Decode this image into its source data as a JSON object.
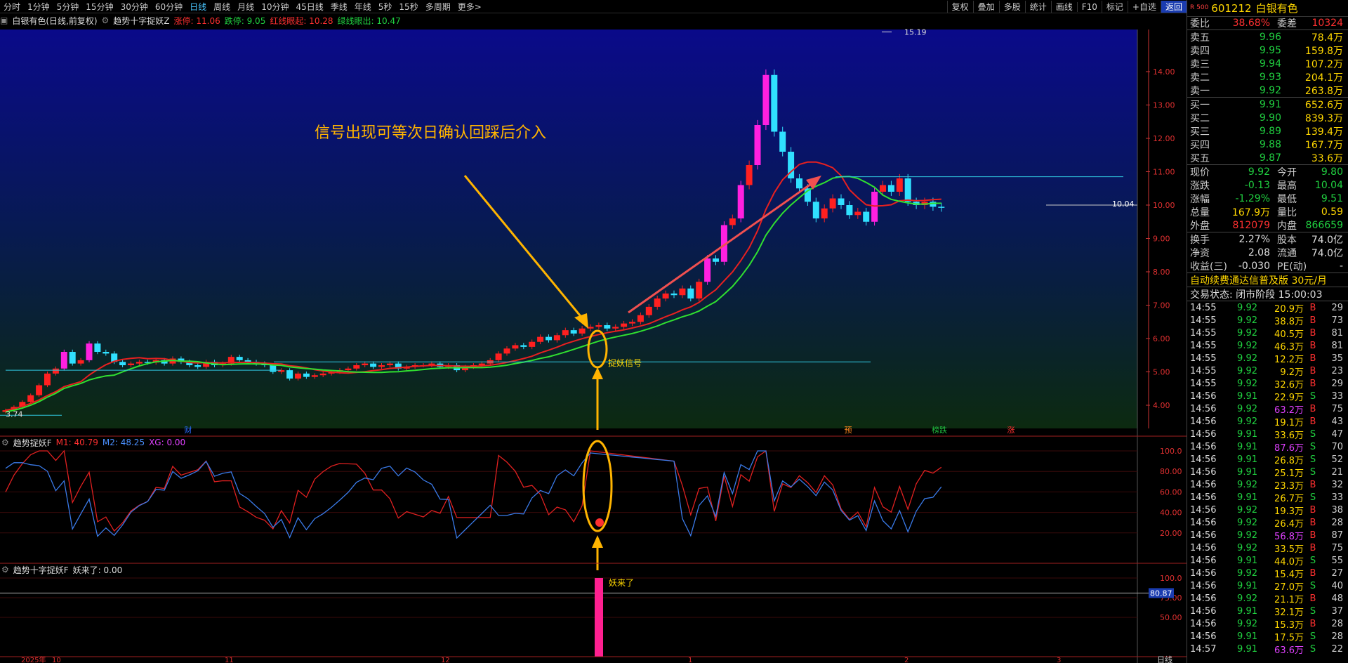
{
  "toolbar": {
    "periods": [
      "分时",
      "1分钟",
      "5分钟",
      "15分钟",
      "30分钟",
      "60分钟",
      "日线",
      "周线",
      "月线",
      "10分钟",
      "45日线",
      "季线",
      "年线",
      "5秒",
      "15秒",
      "多周期",
      "更多>"
    ],
    "active_period": "日线",
    "tools": [
      "复权",
      "叠加",
      "多股",
      "统计",
      "画线",
      "F10",
      "标记",
      "+自选",
      "返回"
    ],
    "active_tool": "返回"
  },
  "main": {
    "title": "白银有色(日线,前复权)",
    "indicator": "趋势十字捉妖Z",
    "limit_up": "涨停: 11.06",
    "limit_down": "跌停: 9.05",
    "red_line": "红线眼起: 10.28",
    "green_line": "绿线眼出: 10.47",
    "y_labels": [
      "14.00",
      "13.00",
      "12.00",
      "11.00",
      "10.00",
      "9.00",
      "8.00",
      "7.00",
      "6.00",
      "5.00",
      "4.00"
    ],
    "high_label": "15.19",
    "low_label": "3.74",
    "current_price_label": "10.04",
    "annotation": "信号出现可等次日确认回踩后介入",
    "signal_label": "捉妖信号",
    "event_badges": [
      "财",
      "预",
      "榜跌",
      "涨"
    ]
  },
  "ind1": {
    "name": "趋势捉妖F",
    "m1": "M1: 40.79",
    "m2": "M2: 48.25",
    "xg": "XG: 0.00",
    "y_labels": [
      "100.0",
      "80.00",
      "60.00",
      "40.00",
      "20.00"
    ]
  },
  "ind2": {
    "name": "趋势十字捉妖F",
    "value": "妖来了: 0.00",
    "y_labels": [
      "100.0",
      "75.00",
      "50.00"
    ],
    "cursor_value": "80.87",
    "bar_label": "妖来了"
  },
  "xaxis": {
    "labels": [
      "2025年",
      "10",
      "11",
      "12",
      "1",
      "2",
      "3"
    ],
    "corner": "日线"
  },
  "quote": {
    "code": "601212",
    "name": "白银有色",
    "badge": "R 500",
    "ratio": {
      "label": "委比",
      "value": "38.68%",
      "label2": "委差",
      "value2": "10324"
    },
    "asks": [
      {
        "label": "卖五",
        "price": "9.96",
        "vol": "78.4万"
      },
      {
        "label": "卖四",
        "price": "9.95",
        "vol": "159.8万"
      },
      {
        "label": "卖三",
        "price": "9.94",
        "vol": "107.2万"
      },
      {
        "label": "卖二",
        "price": "9.93",
        "vol": "204.1万"
      },
      {
        "label": "卖一",
        "price": "9.92",
        "vol": "263.8万"
      }
    ],
    "bids": [
      {
        "label": "买一",
        "price": "9.91",
        "vol": "652.6万"
      },
      {
        "label": "买二",
        "price": "9.90",
        "vol": "839.3万"
      },
      {
        "label": "买三",
        "price": "9.89",
        "vol": "139.4万"
      },
      {
        "label": "买四",
        "price": "9.88",
        "vol": "167.7万"
      },
      {
        "label": "买五",
        "price": "9.87",
        "vol": "33.6万"
      }
    ],
    "stats": [
      {
        "l1": "现价",
        "v1": "9.92",
        "c1": "down",
        "l2": "今开",
        "v2": "9.80",
        "c2": "down"
      },
      {
        "l1": "涨跌",
        "v1": "-0.13",
        "c1": "down",
        "l2": "最高",
        "v2": "10.04",
        "c2": "down"
      },
      {
        "l1": "涨幅",
        "v1": "-1.29%",
        "c1": "down",
        "l2": "最低",
        "v2": "9.51",
        "c2": "down"
      },
      {
        "l1": "总量",
        "v1": "167.9万",
        "c1": "yel",
        "l2": "量比",
        "v2": "0.59",
        "c2": "yel"
      },
      {
        "l1": "外盘",
        "v1": "812079",
        "c1": "up",
        "l2": "内盘",
        "v2": "866659",
        "c2": "down"
      }
    ],
    "stats2": [
      {
        "l1": "换手",
        "v1": "2.27%",
        "l2": "股本",
        "v2": "74.0亿"
      },
      {
        "l1": "净资",
        "v1": "2.08",
        "l2": "流通",
        "v2": "74.0亿"
      },
      {
        "l1": "收益(三)",
        "v1": "-0.030",
        "l2": "PE(动)",
        "v2": "-"
      }
    ],
    "ad": "自动续费通达信普及版  30元/月",
    "trade_status": "交易状态: 闭市阶段 15:00:03"
  },
  "ticks": [
    {
      "t": "14:55",
      "p": "9.92",
      "v": "20.9万",
      "bs": "B",
      "n": "29"
    },
    {
      "t": "14:55",
      "p": "9.92",
      "v": "38.8万",
      "bs": "B",
      "n": "73"
    },
    {
      "t": "14:55",
      "p": "9.92",
      "v": "40.5万",
      "bs": "B",
      "n": "81"
    },
    {
      "t": "14:55",
      "p": "9.92",
      "v": "46.3万",
      "bs": "B",
      "n": "81"
    },
    {
      "t": "14:55",
      "p": "9.92",
      "v": "12.2万",
      "bs": "B",
      "n": "35"
    },
    {
      "t": "14:55",
      "p": "9.92",
      "v": "9.2万",
      "bs": "B",
      "n": "23"
    },
    {
      "t": "14:55",
      "p": "9.92",
      "v": "32.6万",
      "bs": "B",
      "n": "29"
    },
    {
      "t": "14:56",
      "p": "9.91",
      "v": "22.9万",
      "bs": "S",
      "n": "33"
    },
    {
      "t": "14:56",
      "p": "9.92",
      "v": "63.2万",
      "bs": "B",
      "n": "75",
      "hl": true
    },
    {
      "t": "14:56",
      "p": "9.92",
      "v": "19.1万",
      "bs": "B",
      "n": "43"
    },
    {
      "t": "14:56",
      "p": "9.91",
      "v": "33.6万",
      "bs": "S",
      "n": "47"
    },
    {
      "t": "14:56",
      "p": "9.91",
      "v": "87.6万",
      "bs": "S",
      "n": "70",
      "hl": true
    },
    {
      "t": "14:56",
      "p": "9.91",
      "v": "26.8万",
      "bs": "S",
      "n": "52"
    },
    {
      "t": "14:56",
      "p": "9.91",
      "v": "25.1万",
      "bs": "S",
      "n": "21"
    },
    {
      "t": "14:56",
      "p": "9.92",
      "v": "23.3万",
      "bs": "B",
      "n": "32"
    },
    {
      "t": "14:56",
      "p": "9.91",
      "v": "26.7万",
      "bs": "S",
      "n": "33"
    },
    {
      "t": "14:56",
      "p": "9.92",
      "v": "19.3万",
      "bs": "B",
      "n": "38"
    },
    {
      "t": "14:56",
      "p": "9.92",
      "v": "26.4万",
      "bs": "B",
      "n": "28"
    },
    {
      "t": "14:56",
      "p": "9.92",
      "v": "56.8万",
      "bs": "B",
      "n": "87",
      "hl": true
    },
    {
      "t": "14:56",
      "p": "9.92",
      "v": "33.5万",
      "bs": "B",
      "n": "75"
    },
    {
      "t": "14:56",
      "p": "9.91",
      "v": "44.0万",
      "bs": "S",
      "n": "55"
    },
    {
      "t": "14:56",
      "p": "9.92",
      "v": "15.4万",
      "bs": "B",
      "n": "27"
    },
    {
      "t": "14:56",
      "p": "9.91",
      "v": "27.0万",
      "bs": "S",
      "n": "40"
    },
    {
      "t": "14:56",
      "p": "9.92",
      "v": "21.1万",
      "bs": "B",
      "n": "48"
    },
    {
      "t": "14:56",
      "p": "9.91",
      "v": "32.1万",
      "bs": "S",
      "n": "37"
    },
    {
      "t": "14:56",
      "p": "9.92",
      "v": "15.3万",
      "bs": "B",
      "n": "28"
    },
    {
      "t": "14:56",
      "p": "9.91",
      "v": "17.5万",
      "bs": "S",
      "n": "28"
    },
    {
      "t": "14:57",
      "p": "9.91",
      "v": "63.6万",
      "bs": "S",
      "n": "22",
      "hl": true
    }
  ],
  "colors": {
    "up": "#ff2a2a",
    "down": "#20d040",
    "bull_candle": "#ff2020",
    "bear_candle": "#30e0ff",
    "limit_candle": "#ff20e0",
    "ma_red": "#e82020",
    "ma_green": "#30e030",
    "annotation": "#ffb400"
  }
}
